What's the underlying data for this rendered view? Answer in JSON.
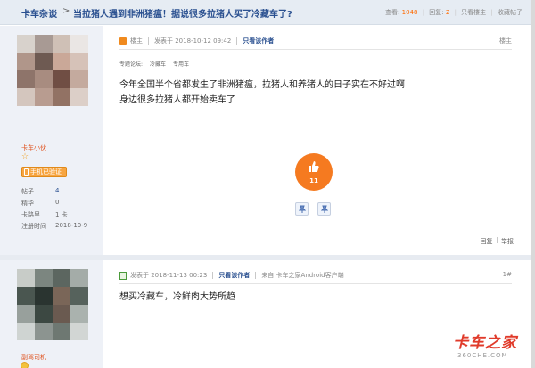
{
  "header": {
    "breadcrumb": "卡车杂谈",
    "separator": ">",
    "thread_title": "当拉猪人遇到非洲猪瘟！据说很多拉猪人买了冷藏车了?",
    "views_label": "查看:",
    "views": "1048",
    "replies_label": "回复:",
    "replies": "2",
    "only_author": "只看楼主",
    "favorite": "收藏帖子"
  },
  "posts": [
    {
      "user": {
        "username": "卡车小伙",
        "badge": "手机已验证",
        "stats": [
          {
            "label": "帖子",
            "value": "4"
          },
          {
            "label": "精华",
            "value": "0"
          },
          {
            "label": "卡路里",
            "value": "1 卡"
          },
          {
            "label": "注册时间",
            "value": "2018-10-9"
          }
        ],
        "avatar_colors": [
          "#d8d2cc",
          "#a89a94",
          "#cfc0b6",
          "#eae6e4",
          "#b0968a",
          "#6e5a52",
          "#caa898",
          "#d6c2b8",
          "#8e746a",
          "#a88c80",
          "#704e44",
          "#c4aa9e",
          "#d4c6be",
          "#b89c90",
          "#927264",
          "#dccfc8"
        ]
      },
      "meta": {
        "role": "楼主",
        "posted": "发表于 2018-10-12 09:42",
        "only_author": "只看该作者",
        "floor": "楼主"
      },
      "tags": {
        "label": "专题论坛:",
        "t1": "冷藏车",
        "t2": "专用车"
      },
      "body": [
        "今年全国半个省都发生了非洲猪瘟，拉猪人和养猪人的日子实在不好过啊",
        "身边很多拉猪人都开始卖车了"
      ],
      "like_count": "11",
      "actions": {
        "reply": "回复",
        "report": "举报"
      }
    },
    {
      "user": {
        "username": "副驾司机",
        "avatar_colors": [
          "#c8ccc8",
          "#7c8680",
          "#5c6660",
          "#a4aca8",
          "#4a5650",
          "#2a3430",
          "#7a6658",
          "#56625c",
          "#98a09c",
          "#3c4842",
          "#6a5a50",
          "#aab2ae",
          "#cfd4d2",
          "#8c9490",
          "#6e7872",
          "#d2d6d4"
        ]
      },
      "meta": {
        "posted": "发表于 2018-11-13 00:23",
        "only_author": "只看该作者",
        "source": "来自 卡车之家Android客户端",
        "floor": "1#"
      },
      "body": [
        "想买冷藏车，冷鲜肉大势所趋"
      ]
    }
  ],
  "watermark": {
    "main": "卡车之家",
    "sub": "360CHE.COM"
  }
}
